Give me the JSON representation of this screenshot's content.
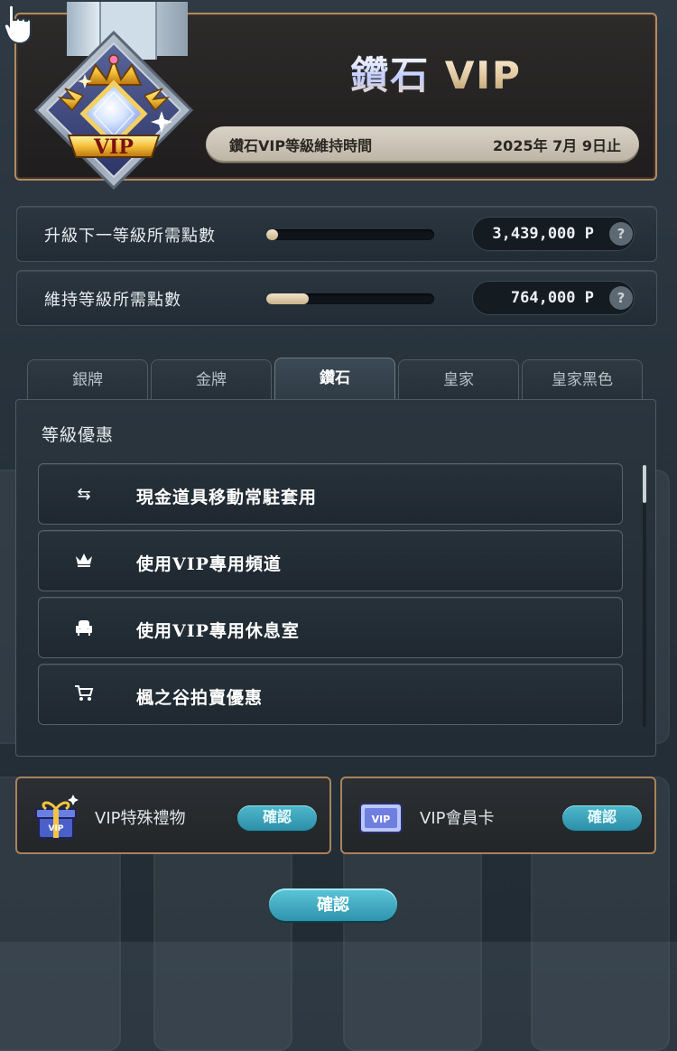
{
  "header": {
    "title_main": "鑽石",
    "title_vip": "VIP",
    "badge_text": "VIP",
    "maintain_label": "鑽石VIP等級維持時間",
    "maintain_date": "2025年 7月 9日止"
  },
  "progress": [
    {
      "label": "升級下一等級所需點數",
      "value": "3,439,000 P",
      "fill_fraction": 0.07
    },
    {
      "label": "維持等級所需點數",
      "value": "764,000 P",
      "fill_fraction": 0.25
    }
  ],
  "help_icon": "?",
  "tabs": [
    {
      "label": "銀牌",
      "active": false
    },
    {
      "label": "金牌",
      "active": false
    },
    {
      "label": "鑽石",
      "active": true
    },
    {
      "label": "皇家",
      "active": false
    },
    {
      "label": "皇家黑色",
      "active": false
    }
  ],
  "benefits": {
    "title": "等級優惠",
    "items": [
      {
        "icon": "swap-arrows-icon",
        "label": "現金道具移動常駐套用"
      },
      {
        "icon": "crown-icon",
        "label": "使用VIP專用頻道"
      },
      {
        "icon": "chair-icon",
        "label": "使用VIP專用休息室"
      },
      {
        "icon": "cart-icon",
        "label": "楓之谷拍賣優惠"
      }
    ]
  },
  "cards": [
    {
      "icon": "gift-box-icon",
      "label": "VIP特殊禮物",
      "button": "確認"
    },
    {
      "icon": "vip-card-icon",
      "label": "VIP會員卡",
      "button": "確認"
    }
  ],
  "confirm_button": "確認",
  "colors": {
    "gold_border": "#b38a5f",
    "accent_button": "#2e94ad",
    "bar_fill": "#d9c7a3"
  }
}
